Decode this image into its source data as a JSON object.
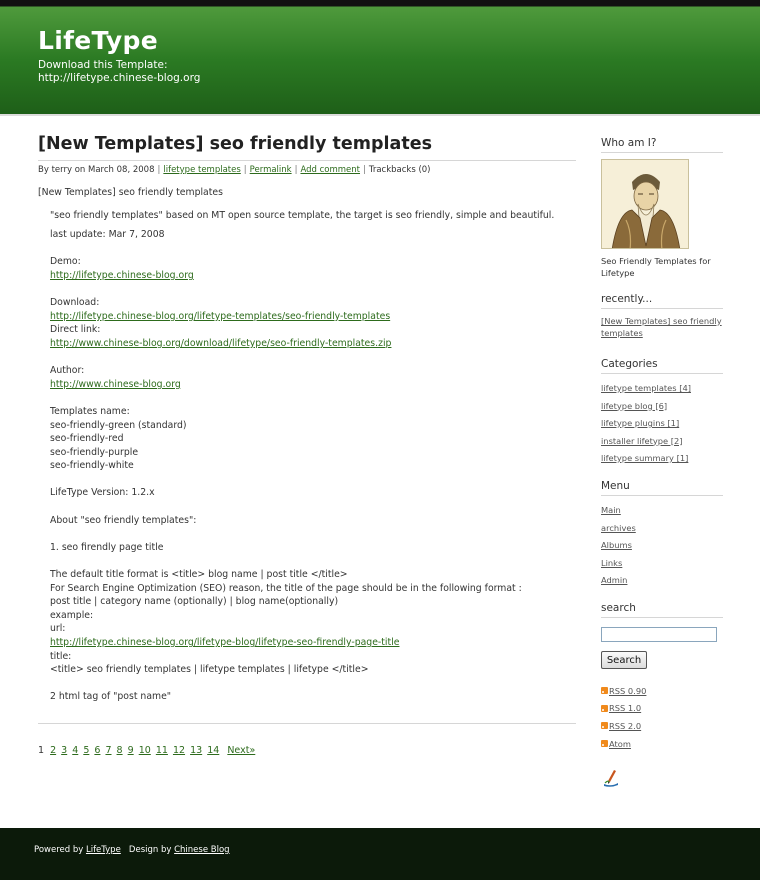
{
  "header": {
    "site_title": "LifeType",
    "description_line1": "Download this Template:",
    "description_line2": "http://lifetype.chinese-blog.org"
  },
  "post": {
    "title": "[New Templates] seo friendly templates",
    "meta": {
      "by_prefix": "By",
      "author": "terry",
      "on": "on",
      "date": "March 08, 2008",
      "category": "lifetype templates",
      "permalink": "Permalink",
      "add_comment": "Add comment",
      "trackbacks": "Trackbacks (0)"
    },
    "intro": "[New Templates] seo friendly templates",
    "summary": "\"seo friendly templates\" based on MT open source template, the target is seo friendly, simple and beautiful.",
    "last_update": "last update: Mar 7, 2008",
    "demo_label": "Demo:",
    "demo_url": "http://lifetype.chinese-blog.org",
    "download_label": "Download:",
    "download_url": "http://lifetype.chinese-blog.org/lifetype-templates/seo-friendly-templates",
    "direct_label": "Direct link:",
    "direct_url": "http://www.chinese-blog.org/download/lifetype/seo-friendly-templates.zip",
    "author_label": "Author:",
    "author_url": "http://www.chinese-blog.org",
    "templates_label": "Templates name:",
    "templates": [
      "seo-friendly-green (standard)",
      "seo-friendly-red",
      "seo-friendly-purple",
      "seo-friendly-white"
    ],
    "version": "LifeType Version: 1.2.x",
    "about": "About \"seo friendly templates\":",
    "point1": "1. seo firendly page title",
    "default_format": "The default title format is <title> blog name | post title </title>",
    "seo_reason": "For Search Engine Optimization (SEO) reason, the title of the page should be in the following format :",
    "format_line": "post title | category name (optionally) | blog name(optionally)",
    "example_label": "example:",
    "url_label": "url:",
    "example_url": "http://lifetype.chinese-blog.org/lifetype-blog/lifetype-seo-firendly-page-title",
    "title_label": "title:",
    "example_title": "<title> seo friendly templates | lifetype templates | lifetype   </title>",
    "point2": "2 html tag of \"post name\""
  },
  "pager": {
    "current": "1",
    "pages": [
      "2",
      "3",
      "4",
      "5",
      "6",
      "7",
      "8",
      "9",
      "10",
      "11",
      "12",
      "13",
      "14"
    ],
    "next": "Next»"
  },
  "sidebar": {
    "who_heading": "Who am I?",
    "who_caption": "Seo Friendly Templates for Lifetype",
    "recent_heading": "recently...",
    "recent_item": "[New Templates] seo friendly templates",
    "categories_heading": "Categories",
    "categories": [
      "lifetype templates [4]",
      "lifetype blog [6]",
      "lifetype plugins [1]",
      "installer lifetype [2]",
      "lifetype summary [1]"
    ],
    "menu_heading": "Menu",
    "menu": [
      "Main",
      "archives",
      "Albums",
      "Links",
      "Admin"
    ],
    "search_heading": "search",
    "search_value": "",
    "search_button": "Search",
    "feeds": [
      "RSS 0.90",
      "RSS 1.0",
      "RSS 2.0",
      "Atom"
    ]
  },
  "footer": {
    "powered_by": "Powered by",
    "lifetype_link": "LifeType",
    "design_by": "Design by",
    "chinese_blog_link": "Chinese Blog"
  },
  "colors": {
    "header_green": "#2b7a23",
    "link_green": "#2d6b1c",
    "footer_bg": "#0c1a0a",
    "rss_orange": "#f08a1c"
  }
}
